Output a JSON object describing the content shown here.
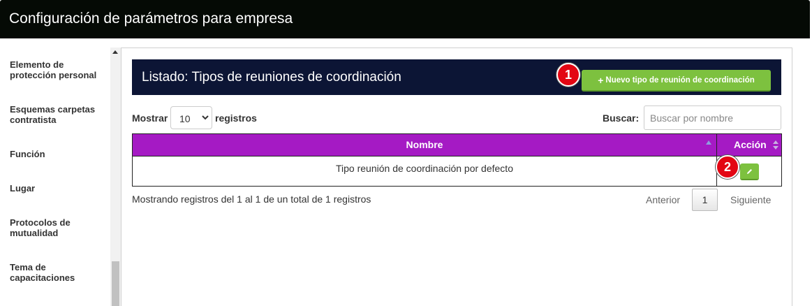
{
  "header": {
    "title": "Configuración de parámetros para empresa"
  },
  "sidebar": {
    "items": [
      {
        "label": "Elemento de protección personal"
      },
      {
        "label": "Esquemas carpetas contratista"
      },
      {
        "label": "Función"
      },
      {
        "label": "Lugar"
      },
      {
        "label": "Protocolos de mutualidad"
      },
      {
        "label": "Tema de capacitaciones"
      }
    ]
  },
  "listing": {
    "title": "Listado: Tipos de reuniones de coordinación",
    "new_button_label": "Nuevo tipo de reunión de coordinación",
    "new_button_icon": "plus-icon"
  },
  "badges": {
    "one": "1",
    "two": "2"
  },
  "controls": {
    "show_label": "Mostrar",
    "show_value": "10",
    "records_label": "registros",
    "search_label": "Buscar:",
    "search_placeholder": "Buscar por nombre",
    "search_value": ""
  },
  "table": {
    "columns": [
      "Nombre",
      "Acción"
    ],
    "rows": [
      {
        "nombre": "Tipo reunión de coordinación por defecto",
        "action_icon": "pencil-icon"
      }
    ]
  },
  "footer": {
    "info": "Mostrando registros del 1 al 1 de un total de 1 registros",
    "prev_label": "Anterior",
    "page": "1",
    "next_label": "Siguiente"
  },
  "colors": {
    "topbar": "#050a05",
    "list_header": "#0c1535",
    "table_header": "#a51ac4",
    "button_green": "#7dc13f",
    "badge_red": "#e30613"
  }
}
